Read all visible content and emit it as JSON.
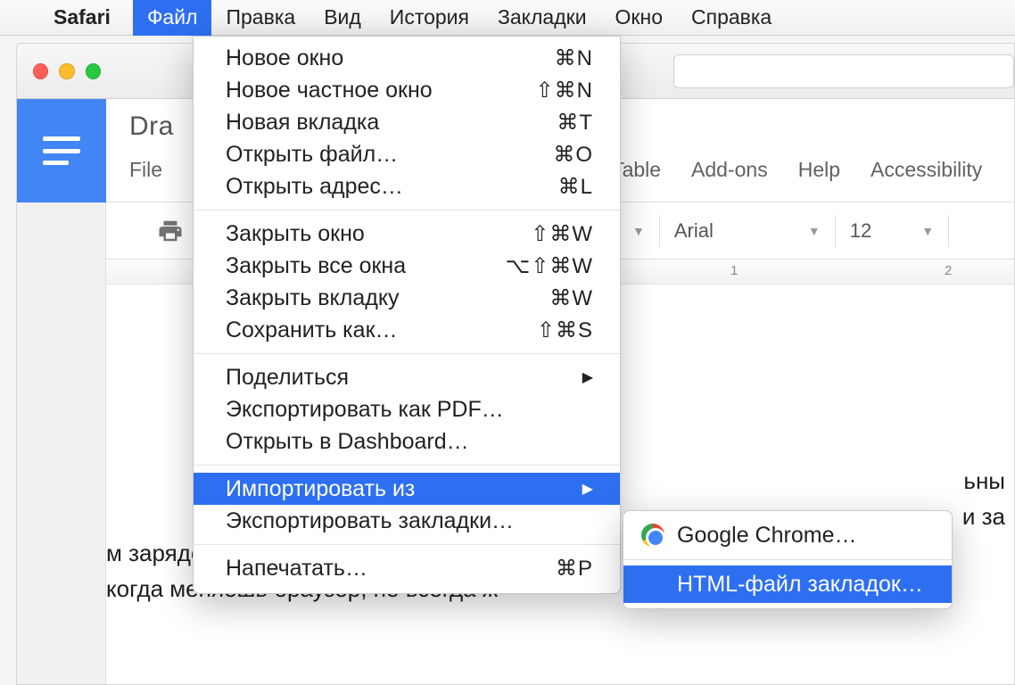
{
  "menubar": {
    "app": "Safari",
    "items": [
      "Файл",
      "Правка",
      "Вид",
      "История",
      "Закладки",
      "Окно",
      "Справка"
    ],
    "active_index": 0
  },
  "dropdown": {
    "groups": [
      [
        {
          "label": "Новое окно",
          "shortcut": "⌘N"
        },
        {
          "label": "Новое частное окно",
          "shortcut": "⇧⌘N"
        },
        {
          "label": "Новая вкладка",
          "shortcut": "⌘T"
        },
        {
          "label": "Открыть файл…",
          "shortcut": "⌘O"
        },
        {
          "label": "Открыть адрес…",
          "shortcut": "⌘L"
        }
      ],
      [
        {
          "label": "Закрыть окно",
          "shortcut": "⇧⌘W"
        },
        {
          "label": "Закрыть все окна",
          "shortcut": "⌥⇧⌘W"
        },
        {
          "label": "Закрыть вкладку",
          "shortcut": "⌘W"
        },
        {
          "label": "Сохранить как…",
          "shortcut": "⇧⌘S"
        }
      ],
      [
        {
          "label": "Поделиться",
          "shortcut": "",
          "submenu": true
        },
        {
          "label": "Экспортировать как PDF…",
          "shortcut": ""
        },
        {
          "label": "Открыть в Dashboard…",
          "shortcut": ""
        }
      ],
      [
        {
          "label": "Импортировать из",
          "shortcut": "",
          "submenu": true,
          "highlight": true
        },
        {
          "label": "Экспортировать закладки…",
          "shortcut": ""
        }
      ],
      [
        {
          "label": "Напечатать…",
          "shortcut": "⌘P"
        }
      ]
    ]
  },
  "submenu": {
    "items": [
      {
        "label": "Google Chrome…",
        "icon": "chrome"
      },
      {
        "label": "HTML-файл закладок…",
        "highlight": true
      }
    ]
  },
  "docs": {
    "title": "Dra",
    "menubar": [
      "File",
      "Table",
      "Add-ons",
      "Help",
      "Accessibility"
    ],
    "font": "Arial",
    "size": "12",
    "ruler": {
      "t1": "1",
      "t2": "2"
    },
    "body_lines": [
      "ьны",
      "и за",
      "м заряде, а свободной операти",
      "когда меняешь браузер, не всегда ж"
    ]
  }
}
